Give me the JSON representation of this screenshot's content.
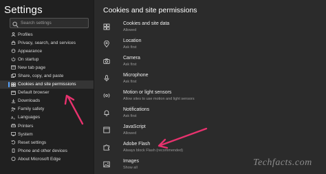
{
  "sidebar": {
    "title": "Settings",
    "search": {
      "placeholder": "Search settings"
    },
    "items": [
      {
        "label": "Profiles",
        "icon": "profile-icon"
      },
      {
        "label": "Privacy, search, and services",
        "icon": "lock-icon"
      },
      {
        "label": "Appearance",
        "icon": "appearance-icon"
      },
      {
        "label": "On startup",
        "icon": "power-icon"
      },
      {
        "label": "New tab page",
        "icon": "new-tab-icon"
      },
      {
        "label": "Share, copy, and paste",
        "icon": "share-icon"
      },
      {
        "label": "Cookies and site permissions",
        "icon": "cookie-icon",
        "active": true
      },
      {
        "label": "Default browser",
        "icon": "browser-icon"
      },
      {
        "label": "Downloads",
        "icon": "download-icon"
      },
      {
        "label": "Family safety",
        "icon": "family-icon"
      },
      {
        "label": "Languages",
        "icon": "languages-icon"
      },
      {
        "label": "Printers",
        "icon": "printer-icon"
      },
      {
        "label": "System",
        "icon": "system-icon"
      },
      {
        "label": "Reset settings",
        "icon": "reset-icon"
      },
      {
        "label": "Phone and other devices",
        "icon": "phone-icon"
      },
      {
        "label": "About Microsoft Edge",
        "icon": "edge-icon"
      }
    ]
  },
  "main": {
    "title": "Cookies and site permissions",
    "permissions": [
      {
        "label": "Cookies and site data",
        "status": "Allowed",
        "icon": "cookie-icon"
      },
      {
        "label": "Location",
        "status": "Ask first",
        "icon": "location-icon"
      },
      {
        "label": "Camera",
        "status": "Ask first",
        "icon": "camera-icon"
      },
      {
        "label": "Microphone",
        "status": "Ask first",
        "icon": "microphone-icon"
      },
      {
        "label": "Motion or light sensors",
        "status": "Allow sites to use motion and light sensors",
        "icon": "sensor-icon"
      },
      {
        "label": "Notifications",
        "status": "Ask first",
        "icon": "bell-icon"
      },
      {
        "label": "JavaScript",
        "status": "Allowed",
        "icon": "javascript-icon"
      },
      {
        "label": "Adobe Flash",
        "status": "Always block Flash (recommended)",
        "icon": "puzzle-icon"
      },
      {
        "label": "Images",
        "status": "Show all",
        "icon": "image-icon"
      }
    ]
  },
  "annotations": {
    "arrow_color": "#e8326e"
  },
  "watermark": "Techfacts.com"
}
